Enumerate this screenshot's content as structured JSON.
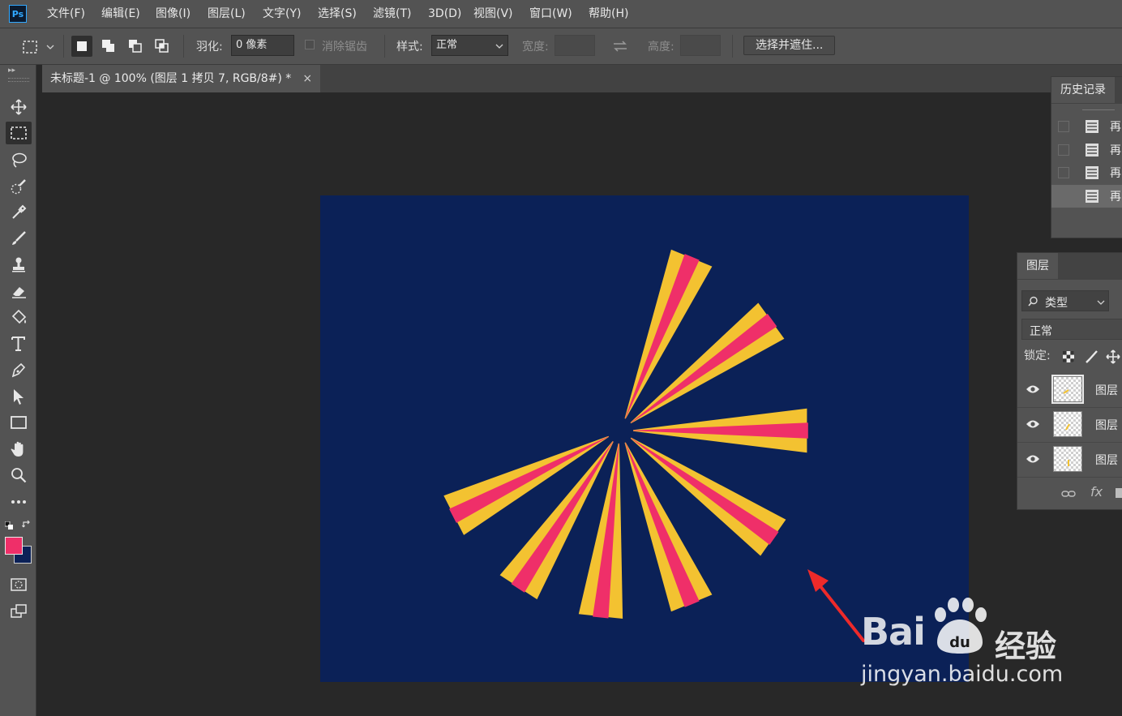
{
  "app": {
    "logo": "Ps"
  },
  "menu": [
    "文件(F)",
    "编辑(E)",
    "图像(I)",
    "图层(L)",
    "文字(Y)",
    "选择(S)",
    "滤镜(T)",
    "3D(D)",
    "视图(V)",
    "窗口(W)",
    "帮助(H)"
  ],
  "options": {
    "feather_label": "羽化:",
    "feather_value": "0 像素",
    "antialias_label": "消除锯齿",
    "style_label": "样式:",
    "style_value": "正常",
    "width_label": "宽度:",
    "height_label": "高度:",
    "select_mask_button": "选择并遮住..."
  },
  "document": {
    "tab_title": "未标题-1 @ 100% (图层 1 拷贝 7, RGB/8#) *",
    "close_glyph": "×",
    "background_color": "#0b2157",
    "ray_colors": {
      "outer": "#f3c231",
      "inner": "#ef2f69"
    },
    "ray_angles_deg": [
      -67.5,
      -36,
      0,
      35,
      67.5,
      96,
      123,
      153
    ]
  },
  "colors": {
    "foreground": "#ef2f69",
    "background": "#0b2157",
    "accent": "#31a8ff"
  },
  "history_panel": {
    "tab": "历史记录",
    "rows": [
      {
        "label": "再"
      },
      {
        "label": "再"
      },
      {
        "label": "再"
      },
      {
        "label": "再"
      }
    ]
  },
  "layers_panel": {
    "tab": "图层",
    "filter_label": "类型",
    "blend_mode": "正常",
    "lock_label": "锁定:",
    "layers": [
      {
        "name": "图层",
        "selected": true
      },
      {
        "name": "图层",
        "selected": false
      },
      {
        "name": "图层",
        "selected": false
      }
    ],
    "footer_fx": "fx"
  },
  "watermark": {
    "brand": "Bai",
    "brand_suffix": "经验",
    "url": "jingyan.baidu.com"
  }
}
